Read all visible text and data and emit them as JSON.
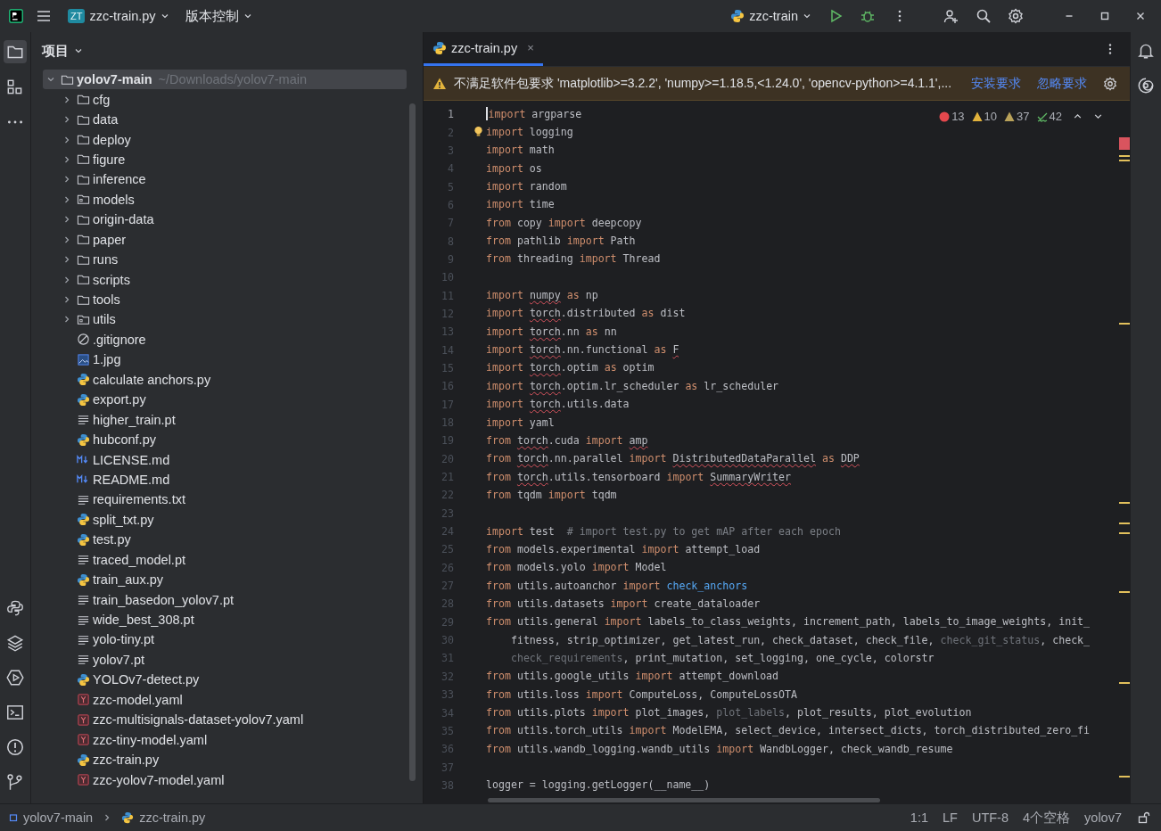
{
  "title_bar": {
    "project_badge": "ZT",
    "project": "zzc-train.py",
    "vcs": "版本控制",
    "run_config": "zzc-train"
  },
  "project_panel": {
    "title": "项目",
    "tree": [
      {
        "name": "yolov7-main",
        "path": "~/Downloads/yolov7-main",
        "kind": "folder",
        "expanded": true,
        "selected": true,
        "children": [
          {
            "name": "cfg",
            "kind": "folder",
            "expanded": false
          },
          {
            "name": "data",
            "kind": "folder",
            "expanded": false
          },
          {
            "name": "deploy",
            "kind": "folder",
            "expanded": false
          },
          {
            "name": "figure",
            "kind": "folder",
            "expanded": false
          },
          {
            "name": "inference",
            "kind": "folder",
            "expanded": false
          },
          {
            "name": "models",
            "kind": "package",
            "expanded": false
          },
          {
            "name": "origin-data",
            "kind": "folder",
            "expanded": false
          },
          {
            "name": "paper",
            "kind": "folder",
            "expanded": false
          },
          {
            "name": "runs",
            "kind": "folder",
            "expanded": false
          },
          {
            "name": "scripts",
            "kind": "folder",
            "expanded": false
          },
          {
            "name": "tools",
            "kind": "folder",
            "expanded": false
          },
          {
            "name": "utils",
            "kind": "package",
            "expanded": false
          },
          {
            "name": ".gitignore",
            "kind": "ignore"
          },
          {
            "name": "1.jpg",
            "kind": "image"
          },
          {
            "name": "calculate anchors.py",
            "kind": "python"
          },
          {
            "name": "export.py",
            "kind": "python"
          },
          {
            "name": "higher_train.pt",
            "kind": "text"
          },
          {
            "name": "hubconf.py",
            "kind": "python"
          },
          {
            "name": "LICENSE.md",
            "kind": "markdown"
          },
          {
            "name": "README.md",
            "kind": "markdown"
          },
          {
            "name": "requirements.txt",
            "kind": "text"
          },
          {
            "name": "split_txt.py",
            "kind": "python"
          },
          {
            "name": "test.py",
            "kind": "python"
          },
          {
            "name": "traced_model.pt",
            "kind": "text"
          },
          {
            "name": "train_aux.py",
            "kind": "python"
          },
          {
            "name": "train_basedon_yolov7.pt",
            "kind": "text"
          },
          {
            "name": "wide_best_308.pt",
            "kind": "text"
          },
          {
            "name": "yolo-tiny.pt",
            "kind": "text"
          },
          {
            "name": "yolov7.pt",
            "kind": "text"
          },
          {
            "name": "YOLOv7-detect.py",
            "kind": "python"
          },
          {
            "name": "zzc-model.yaml",
            "kind": "yaml"
          },
          {
            "name": "zzc-multisignals-dataset-yolov7.yaml",
            "kind": "yaml"
          },
          {
            "name": "zzc-tiny-model.yaml",
            "kind": "yaml"
          },
          {
            "name": "zzc-train.py",
            "kind": "python"
          },
          {
            "name": "zzc-yolov7-model.yaml",
            "kind": "yaml"
          }
        ]
      }
    ]
  },
  "editor": {
    "tabs": [
      {
        "label": "zzc-train.py",
        "close": "×",
        "selected": true
      }
    ],
    "banner": {
      "message": "不满足软件包要求 'matplotlib>=3.2.2', 'numpy>=1.18.5,<1.24.0', 'opencv-python>=4.1.1',...",
      "actions": [
        "安装要求",
        "忽略要求"
      ]
    },
    "inspections": [
      {
        "kind": "error",
        "count": "13"
      },
      {
        "kind": "warning",
        "count": "10"
      },
      {
        "kind": "weak",
        "count": "37"
      },
      {
        "kind": "typo",
        "count": "42"
      }
    ],
    "lines": [
      {
        "number": "1",
        "current": true,
        "tokens": [
          {
            "text": "import",
            "kind": "kw"
          },
          {
            "text": " argparse",
            "kind": "plain"
          }
        ]
      },
      {
        "number": "2",
        "current": false,
        "tokens": [
          {
            "text": "import",
            "kind": "kw"
          },
          {
            "text": " logging",
            "kind": "plain"
          }
        ]
      },
      {
        "number": "3",
        "current": false,
        "tokens": [
          {
            "text": "import",
            "kind": "kw"
          },
          {
            "text": " math",
            "kind": "plain"
          }
        ]
      },
      {
        "number": "4",
        "current": false,
        "tokens": [
          {
            "text": "import",
            "kind": "kw"
          },
          {
            "text": " os",
            "kind": "plain"
          }
        ]
      },
      {
        "number": "5",
        "current": false,
        "tokens": [
          {
            "text": "import",
            "kind": "kw"
          },
          {
            "text": " random",
            "kind": "plain"
          }
        ]
      },
      {
        "number": "6",
        "current": false,
        "tokens": [
          {
            "text": "import",
            "kind": "kw"
          },
          {
            "text": " time",
            "kind": "plain"
          }
        ]
      },
      {
        "number": "7",
        "current": false,
        "tokens": [
          {
            "text": "from",
            "kind": "kw"
          },
          {
            "text": " copy ",
            "kind": "plain"
          },
          {
            "text": "import",
            "kind": "kw"
          },
          {
            "text": " deepcopy",
            "kind": "plain"
          }
        ]
      },
      {
        "number": "8",
        "current": false,
        "tokens": [
          {
            "text": "from",
            "kind": "kw"
          },
          {
            "text": " pathlib ",
            "kind": "plain"
          },
          {
            "text": "import",
            "kind": "kw"
          },
          {
            "text": " Path",
            "kind": "plain"
          }
        ]
      },
      {
        "number": "9",
        "current": false,
        "tokens": [
          {
            "text": "from",
            "kind": "kw"
          },
          {
            "text": " threading ",
            "kind": "plain"
          },
          {
            "text": "import",
            "kind": "kw"
          },
          {
            "text": " Thread",
            "kind": "plain"
          }
        ]
      },
      {
        "number": "10",
        "current": false
      },
      {
        "number": "11",
        "current": false,
        "tokens": [
          {
            "text": "import ",
            "kind": "kw"
          },
          {
            "text": "numpy",
            "kind": "error"
          },
          {
            "text": " as",
            "kind": "kw"
          },
          {
            "text": " np",
            "kind": "plain"
          }
        ]
      },
      {
        "number": "12",
        "current": false,
        "tokens": [
          {
            "text": "import ",
            "kind": "kw"
          },
          {
            "text": "torch",
            "kind": "error"
          },
          {
            "text": ".distributed ",
            "kind": "plain"
          },
          {
            "text": "as",
            "kind": "kw"
          },
          {
            "text": " dist",
            "kind": "plain"
          }
        ]
      },
      {
        "number": "13",
        "current": false,
        "tokens": [
          {
            "text": "import ",
            "kind": "kw"
          },
          {
            "text": "torch",
            "kind": "error"
          },
          {
            "text": ".nn ",
            "kind": "plain"
          },
          {
            "text": "as",
            "kind": "kw"
          },
          {
            "text": " nn",
            "kind": "plain"
          }
        ]
      },
      {
        "number": "14",
        "current": false,
        "tokens": [
          {
            "text": "import ",
            "kind": "kw"
          },
          {
            "text": "torch",
            "kind": "error"
          },
          {
            "text": ".nn.functional ",
            "kind": "plain"
          },
          {
            "text": "as ",
            "kind": "kw"
          },
          {
            "text": "F",
            "kind": "error"
          }
        ]
      },
      {
        "number": "15",
        "current": false,
        "tokens": [
          {
            "text": "import ",
            "kind": "kw"
          },
          {
            "text": "torch",
            "kind": "error"
          },
          {
            "text": ".optim ",
            "kind": "plain"
          },
          {
            "text": "as",
            "kind": "kw"
          },
          {
            "text": " optim",
            "kind": "plain"
          }
        ]
      },
      {
        "number": "16",
        "current": false,
        "tokens": [
          {
            "text": "import ",
            "kind": "kw"
          },
          {
            "text": "torch",
            "kind": "error"
          },
          {
            "text": ".optim.lr_scheduler ",
            "kind": "plain"
          },
          {
            "text": "as",
            "kind": "kw"
          },
          {
            "text": " lr_scheduler",
            "kind": "plain"
          }
        ]
      },
      {
        "number": "17",
        "current": false,
        "tokens": [
          {
            "text": "import ",
            "kind": "kw"
          },
          {
            "text": "torch",
            "kind": "error"
          },
          {
            "text": ".utils.data",
            "kind": "plain"
          }
        ]
      },
      {
        "number": "18",
        "current": false,
        "tokens": [
          {
            "text": "import",
            "kind": "kw"
          },
          {
            "text": " yaml",
            "kind": "plain"
          }
        ]
      },
      {
        "number": "19",
        "current": false,
        "tokens": [
          {
            "text": "from ",
            "kind": "kw"
          },
          {
            "text": "torch",
            "kind": "error"
          },
          {
            "text": ".cuda ",
            "kind": "plain"
          },
          {
            "text": "import ",
            "kind": "kw"
          },
          {
            "text": "amp",
            "kind": "error"
          }
        ]
      },
      {
        "number": "20",
        "current": false,
        "tokens": [
          {
            "text": "from ",
            "kind": "kw"
          },
          {
            "text": "torch",
            "kind": "error"
          },
          {
            "text": ".nn.parallel ",
            "kind": "plain"
          },
          {
            "text": "import ",
            "kind": "kw"
          },
          {
            "text": "DistributedDataParallel",
            "kind": "error"
          },
          {
            "text": " as ",
            "kind": "kw"
          },
          {
            "text": "DDP",
            "kind": "error"
          }
        ]
      },
      {
        "number": "21",
        "current": false,
        "tokens": [
          {
            "text": "from ",
            "kind": "kw"
          },
          {
            "text": "torch",
            "kind": "error"
          },
          {
            "text": ".utils.tensorboard ",
            "kind": "plain"
          },
          {
            "text": "import ",
            "kind": "kw"
          },
          {
            "text": "SummaryWriter",
            "kind": "error"
          }
        ]
      },
      {
        "number": "22",
        "current": false,
        "tokens": [
          {
            "text": "from",
            "kind": "kw"
          },
          {
            "text": " tqdm ",
            "kind": "plain"
          },
          {
            "text": "import",
            "kind": "kw"
          },
          {
            "text": " tqdm",
            "kind": "plain"
          }
        ]
      },
      {
        "number": "23",
        "current": false
      },
      {
        "number": "24",
        "current": false,
        "tokens": [
          {
            "text": "import",
            "kind": "kw"
          },
          {
            "text": " test  ",
            "kind": "plain"
          },
          {
            "text": "# import test.py to get mAP after each epoch",
            "kind": "comment"
          }
        ]
      },
      {
        "number": "25",
        "current": false,
        "tokens": [
          {
            "text": "from",
            "kind": "kw"
          },
          {
            "text": " models.experimental ",
            "kind": "plain"
          },
          {
            "text": "import",
            "kind": "kw"
          },
          {
            "text": " attempt_load",
            "kind": "plain"
          }
        ]
      },
      {
        "number": "26",
        "current": false,
        "tokens": [
          {
            "text": "from",
            "kind": "kw"
          },
          {
            "text": " models.yolo ",
            "kind": "plain"
          },
          {
            "text": "import",
            "kind": "kw"
          },
          {
            "text": " Model",
            "kind": "plain"
          }
        ]
      },
      {
        "number": "27",
        "current": false,
        "tokens": [
          {
            "text": "from",
            "kind": "kw"
          },
          {
            "text": " utils.autoanchor ",
            "kind": "plain"
          },
          {
            "text": "import ",
            "kind": "kw"
          },
          {
            "text": "check_anchors",
            "kind": "call"
          }
        ]
      },
      {
        "number": "28",
        "current": false,
        "tokens": [
          {
            "text": "from",
            "kind": "kw"
          },
          {
            "text": " utils.datasets ",
            "kind": "plain"
          },
          {
            "text": "import",
            "kind": "kw"
          },
          {
            "text": " create_dataloader",
            "kind": "plain"
          }
        ]
      },
      {
        "number": "29",
        "current": false,
        "tokens": [
          {
            "text": "from",
            "kind": "kw"
          },
          {
            "text": " utils.general ",
            "kind": "plain"
          },
          {
            "text": "import",
            "kind": "kw"
          },
          {
            "text": " labels_to_class_weights, increment_path, labels_to_image_weights, init_",
            "kind": "plain"
          }
        ]
      },
      {
        "number": "30",
        "current": false,
        "tokens": [
          {
            "text": "    fitness, strip_optimizer, get_latest_run, check_dataset, check_file, ",
            "kind": "plain"
          },
          {
            "text": "check_git_status",
            "kind": "unused"
          },
          {
            "text": ", check_",
            "kind": "plain"
          }
        ]
      },
      {
        "number": "31",
        "current": false,
        "tokens": [
          {
            "text": "    check_requirements",
            "kind": "unused"
          },
          {
            "text": ", print_mutation, set_logging, one_cycle, colorstr",
            "kind": "plain"
          }
        ]
      },
      {
        "number": "32",
        "current": false,
        "tokens": [
          {
            "text": "from",
            "kind": "kw"
          },
          {
            "text": " utils.google_utils ",
            "kind": "plain"
          },
          {
            "text": "import",
            "kind": "kw"
          },
          {
            "text": " attempt_download",
            "kind": "plain"
          }
        ]
      },
      {
        "number": "33",
        "current": false,
        "tokens": [
          {
            "text": "from",
            "kind": "kw"
          },
          {
            "text": " utils.loss ",
            "kind": "plain"
          },
          {
            "text": "import",
            "kind": "kw"
          },
          {
            "text": " ComputeLoss, ComputeLossOTA",
            "kind": "plain"
          }
        ]
      },
      {
        "number": "34",
        "current": false,
        "tokens": [
          {
            "text": "from",
            "kind": "kw"
          },
          {
            "text": " utils.plots ",
            "kind": "plain"
          },
          {
            "text": "import",
            "kind": "kw"
          },
          {
            "text": " plot_images, ",
            "kind": "plain"
          },
          {
            "text": "plot_labels",
            "kind": "unused"
          },
          {
            "text": ", plot_results, plot_evolution",
            "kind": "plain"
          }
        ]
      },
      {
        "number": "35",
        "current": false,
        "tokens": [
          {
            "text": "from",
            "kind": "kw"
          },
          {
            "text": " utils.torch_utils ",
            "kind": "plain"
          },
          {
            "text": "import",
            "kind": "kw"
          },
          {
            "text": " ModelEMA, select_device, intersect_dicts, torch_distributed_zero_fi",
            "kind": "plain"
          }
        ]
      },
      {
        "number": "36",
        "current": false,
        "tokens": [
          {
            "text": "from",
            "kind": "kw"
          },
          {
            "text": " utils.wandb_logging.wandb_utils ",
            "kind": "plain"
          },
          {
            "text": "import",
            "kind": "kw"
          },
          {
            "text": " WandbLogger, check_wandb_resume",
            "kind": "plain"
          }
        ]
      },
      {
        "number": "37",
        "current": false
      },
      {
        "number": "38",
        "current": false,
        "tokens": [
          {
            "text": "logger = logging.getLogger(__name__)",
            "kind": "plain"
          }
        ]
      }
    ]
  },
  "status_bar": {
    "breadcrumb": [
      "yolov7-main",
      "zzc-train.py"
    ],
    "items": [
      "1:1",
      "LF",
      "UTF-8",
      "4个空格",
      "yolov7"
    ]
  }
}
